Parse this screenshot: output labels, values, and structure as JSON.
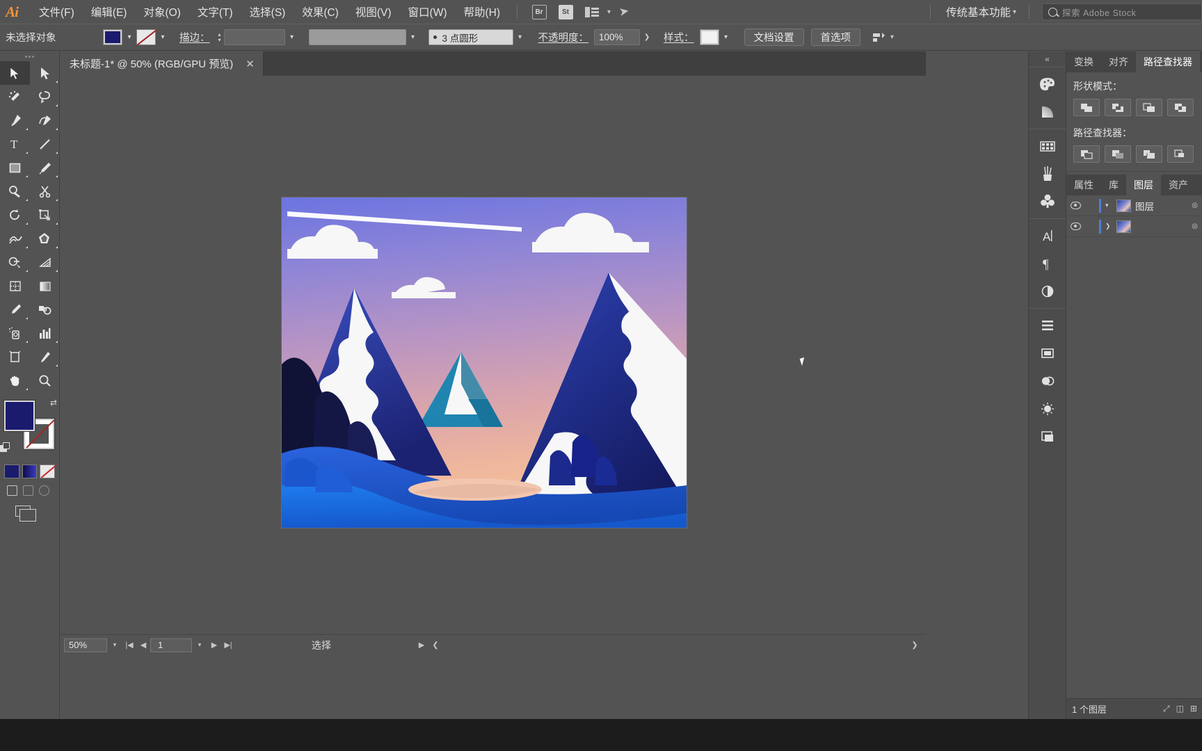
{
  "app": {
    "logo": "Ai",
    "menu": [
      {
        "label": "文件(F)",
        "name": "menu-file"
      },
      {
        "label": "编辑(E)",
        "name": "menu-edit"
      },
      {
        "label": "对象(O)",
        "name": "menu-object"
      },
      {
        "label": "文字(T)",
        "name": "menu-type"
      },
      {
        "label": "选择(S)",
        "name": "menu-select"
      },
      {
        "label": "效果(C)",
        "name": "menu-effect"
      },
      {
        "label": "视图(V)",
        "name": "menu-view"
      },
      {
        "label": "窗口(W)",
        "name": "menu-window"
      },
      {
        "label": "帮助(H)",
        "name": "menu-help"
      }
    ],
    "bridge_icon_label": "Br",
    "stock_icon_label": "St",
    "workspace": "传统基本功能",
    "search_placeholder": "探索 Adobe Stock"
  },
  "control_bar": {
    "selection_status": "未选择对象",
    "fill_color": "#1b1b6e",
    "stroke_label": "描边：",
    "stroke_weight": "",
    "brush_definition": "3 点圆形",
    "opacity_label": "不透明度：",
    "opacity_value": "100%",
    "style_label": "样式：",
    "document_setup": "文档设置",
    "preferences": "首选项"
  },
  "tab": {
    "title": "未标题-1* @ 50% (RGB/GPU 预览)",
    "close": "✕"
  },
  "statusbar": {
    "zoom": "50%",
    "page": "1",
    "status_text": "选择",
    "first_icon": "|◀",
    "prev_icon": "◀",
    "next_icon": "▶",
    "last_icon": "▶|"
  },
  "toolbar": {
    "tools": [
      {
        "name": "selection-tool",
        "label": "选择工具"
      },
      {
        "name": "direct-selection-tool",
        "label": "直接选择工具"
      },
      {
        "name": "magic-wand-tool",
        "label": "魔棒工具"
      },
      {
        "name": "lasso-tool",
        "label": "套索工具"
      },
      {
        "name": "pen-tool",
        "label": "钢笔工具"
      },
      {
        "name": "curvature-tool",
        "label": "曲率工具"
      },
      {
        "name": "type-tool",
        "label": "文字工具"
      },
      {
        "name": "line-segment-tool",
        "label": "直线段工具"
      },
      {
        "name": "rectangle-tool",
        "label": "矩形工具"
      },
      {
        "name": "paintbrush-tool",
        "label": "画笔工具"
      },
      {
        "name": "shaper-tool",
        "label": "Shaper 工具"
      },
      {
        "name": "scissors-tool",
        "label": "剪刀工具"
      },
      {
        "name": "rotate-tool",
        "label": "旋转工具"
      },
      {
        "name": "scale-tool",
        "label": "比例缩放工具"
      },
      {
        "name": "width-tool",
        "label": "宽度工具"
      },
      {
        "name": "free-transform-tool",
        "label": "自由变换工具"
      },
      {
        "name": "shape-builder-tool",
        "label": "形状生成器工具"
      },
      {
        "name": "perspective-grid-tool",
        "label": "透视网格工具"
      },
      {
        "name": "mesh-tool",
        "label": "网格工具"
      },
      {
        "name": "gradient-tool",
        "label": "渐变工具"
      },
      {
        "name": "eyedropper-tool",
        "label": "吸管工具"
      },
      {
        "name": "blend-tool",
        "label": "混合工具"
      },
      {
        "name": "symbol-sprayer-tool",
        "label": "符号喷枪工具"
      },
      {
        "name": "column-graph-tool",
        "label": "柱形图工具"
      },
      {
        "name": "artboard-tool",
        "label": "画板工具"
      },
      {
        "name": "slice-tool",
        "label": "切片工具"
      },
      {
        "name": "hand-tool",
        "label": "抓手工具"
      },
      {
        "name": "zoom-tool",
        "label": "缩放工具"
      }
    ],
    "fill_color": "#1b1b6e",
    "stroke_color": "none"
  },
  "dock": {
    "icons": [
      {
        "name": "color-panel-icon",
        "label": "颜色"
      },
      {
        "name": "gradient-panel-icon",
        "label": "渐变"
      },
      {
        "name": "swatches-panel-icon",
        "label": "色板"
      },
      {
        "name": "brushes-panel-icon",
        "label": "画笔"
      },
      {
        "name": "symbols-panel-icon",
        "label": "符号"
      },
      {
        "name": "character-panel-icon",
        "label": "字符"
      },
      {
        "name": "paragraph-panel-icon",
        "label": "段落"
      },
      {
        "name": "transparency-panel-icon",
        "label": "透明度"
      },
      {
        "name": "align-panel-icon",
        "label": "对齐"
      },
      {
        "name": "artboards-panel-icon",
        "label": "画板"
      },
      {
        "name": "appearance-panel-icon",
        "label": "外观"
      },
      {
        "name": "graphic-styles-panel-icon",
        "label": "图形样式"
      },
      {
        "name": "image-trace-panel-icon",
        "label": "图像描摹"
      }
    ]
  },
  "right_panels": {
    "top_tabs": [
      {
        "label": "变换",
        "name": "tab-transform",
        "active": false
      },
      {
        "label": "对齐",
        "name": "tab-align",
        "active": false
      },
      {
        "label": "路径查找器",
        "name": "tab-pathfinder",
        "active": true
      }
    ],
    "pathfinder": {
      "shape_modes_title": "形状模式：",
      "pathfinders_title": "路径查找器：",
      "shape_mode_buttons": [
        "unite",
        "minus-front",
        "intersect",
        "exclude"
      ],
      "pathfinder_buttons": [
        "divide",
        "trim",
        "merge",
        "crop"
      ]
    },
    "bottom_tabs": [
      {
        "label": "属性",
        "name": "tab-properties",
        "active": false
      },
      {
        "label": "库",
        "name": "tab-libraries",
        "active": false
      },
      {
        "label": "图层",
        "name": "tab-layers",
        "active": true
      },
      {
        "label": "资产",
        "name": "tab-assets",
        "active": false
      }
    ],
    "layers": [
      {
        "name": "图层",
        "visible": true,
        "locked": false,
        "expanded": false,
        "color": "#4f7dd6"
      },
      {
        "name": "",
        "visible": true,
        "locked": false,
        "expanded": false,
        "color": "#4f7dd6"
      }
    ],
    "layers_count": "1 个图层"
  },
  "artwork": {
    "description": "扁平插画风格的山脉风景，带颗粒质感",
    "palette": {
      "sky_top": "#6f74d8",
      "sky_mid": "#9c8fd0",
      "sky_low": "#d79ca8",
      "sky_bottom": "#f0b79b",
      "mountain_dark": "#141449",
      "mountain_navy": "#25287a",
      "mountain_blue": "#2f3fa0",
      "mountain_mid": "#3452b8",
      "teal": "#1f7fa8",
      "snow": "#f7f7f7",
      "foreground_blue": "#1f5fd0",
      "bright_blue": "#1e7ae0",
      "sand": "#f2c4ae"
    }
  }
}
